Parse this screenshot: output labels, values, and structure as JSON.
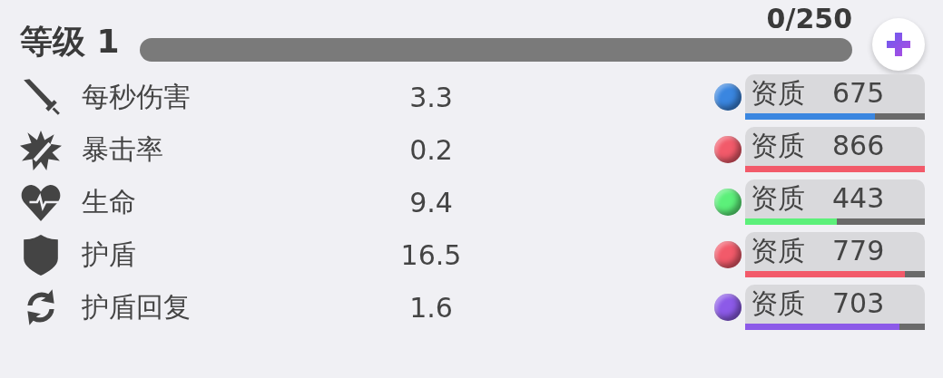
{
  "level": {
    "label": "等级 1",
    "progress": "0/250",
    "level": 0
  },
  "stats": [
    {
      "name": "每秒伤害",
      "value": "3.3",
      "quality_label": "资质",
      "quality": "675",
      "level": 0.72,
      "color": "#3a86e0"
    },
    {
      "name": "暴击率",
      "value": "0.2",
      "quality_label": "资质",
      "quality": "866",
      "level": 1.0,
      "color": "#f25a6a"
    },
    {
      "name": "生命",
      "value": "9.4",
      "quality_label": "资质",
      "quality": "443",
      "level": 0.51,
      "color": "#5cf07a"
    },
    {
      "name": "护盾",
      "value": "16.5",
      "quality_label": "资质",
      "quality": "779",
      "level": 0.89,
      "color": "#f25a6a"
    },
    {
      "name": "护盾回复",
      "value": "1.6",
      "quality_label": "资质",
      "quality": "703",
      "level": 0.86,
      "color": "#8c5ae8"
    }
  ]
}
